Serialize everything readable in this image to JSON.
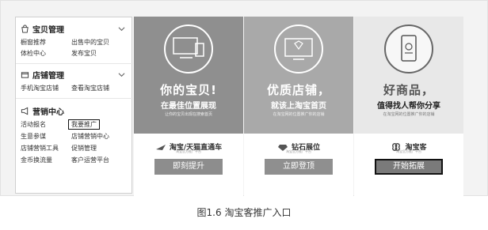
{
  "sidebar": {
    "baby": {
      "title": "宝贝管理",
      "links": [
        "橱窗推荐",
        "出售中的宝贝",
        "体检中心",
        "发布宝贝"
      ]
    },
    "shop": {
      "title": "店铺管理",
      "links": [
        "手机淘宝店铺",
        "查看淘宝店铺"
      ]
    },
    "marketing": {
      "title": "营销中心",
      "links": [
        "活动报名",
        "我要推广",
        "生意参谋",
        "店铺营销中心",
        "店铺营销工具",
        "促销管理",
        "金币换流量",
        "客户运营平台"
      ]
    }
  },
  "panels": [
    {
      "headline_a": "你的",
      "headline_b": "宝贝",
      "headline_c": "!",
      "subline": "在最佳位置展现",
      "fine": "让你的宝贝出现在搜索首页",
      "brand": "淘宝/天猫直通车",
      "brand_sub": "淘宝官方推广平台",
      "button": "即刻提升"
    },
    {
      "headline_a": "优质",
      "headline_b": "店铺",
      "headline_c": "，",
      "subline": "就该上淘宝首页",
      "fine": "在淘宝网的位置推广你的店铺",
      "brand": "钻石展位",
      "brand_sub": "淘宝官方推广平台",
      "button": "立即登顶"
    },
    {
      "headline_a": "好商品",
      "headline_b": "",
      "headline_c": "，",
      "subline_a": "值得找人帮你",
      "subline_b": "分享",
      "fine": "在淘宝网的位置推广你的店铺",
      "brand": "淘宝客",
      "brand_sub": "淘宝官方推广平台",
      "button": "开始拓展"
    }
  ],
  "caption": "图1.6  淘宝客推广入口"
}
